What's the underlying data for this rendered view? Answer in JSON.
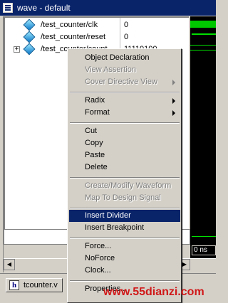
{
  "window": {
    "title": "wave - default"
  },
  "signals": [
    {
      "name": "/test_counter/clk",
      "value": "0",
      "expandable": false
    },
    {
      "name": "/test_counter/reset",
      "value": "0",
      "expandable": false
    },
    {
      "name": "/test_counter/count",
      "value": "11110100",
      "expandable": true
    }
  ],
  "wave": {
    "time_readout": "0 ns"
  },
  "context_menu": {
    "groups": [
      [
        {
          "label": "Object Declaration",
          "enabled": true,
          "submenu": false
        },
        {
          "label": "View Assertion",
          "enabled": false,
          "submenu": false
        },
        {
          "label": "Cover Directive View",
          "enabled": false,
          "submenu": true
        }
      ],
      [
        {
          "label": "Radix",
          "enabled": true,
          "submenu": true
        },
        {
          "label": "Format",
          "enabled": true,
          "submenu": true
        }
      ],
      [
        {
          "label": "Cut",
          "enabled": true,
          "submenu": false
        },
        {
          "label": "Copy",
          "enabled": true,
          "submenu": false
        },
        {
          "label": "Paste",
          "enabled": true,
          "submenu": false
        },
        {
          "label": "Delete",
          "enabled": true,
          "submenu": false
        }
      ],
      [
        {
          "label": "Create/Modify Waveform",
          "enabled": false,
          "submenu": false
        },
        {
          "label": "Map To Design Signal",
          "enabled": false,
          "submenu": false
        }
      ],
      [
        {
          "label": "Insert Divider",
          "enabled": true,
          "submenu": false,
          "selected": true
        },
        {
          "label": "Insert Breakpoint",
          "enabled": true,
          "submenu": false
        }
      ],
      [
        {
          "label": "Force...",
          "enabled": true,
          "submenu": false
        },
        {
          "label": "NoForce",
          "enabled": true,
          "submenu": false
        },
        {
          "label": "Clock...",
          "enabled": true,
          "submenu": false
        }
      ],
      [
        {
          "label": "Properties...",
          "enabled": true,
          "submenu": false
        }
      ]
    ]
  },
  "tabs": [
    {
      "label": "tcounter.v",
      "icon": "file-h-icon"
    }
  ],
  "watermark": "www.55dianzi.com",
  "colors": {
    "titlebar": "#0a246a",
    "selection": "#0a246a",
    "wave": "#00e000",
    "watermark": "#d01818"
  }
}
